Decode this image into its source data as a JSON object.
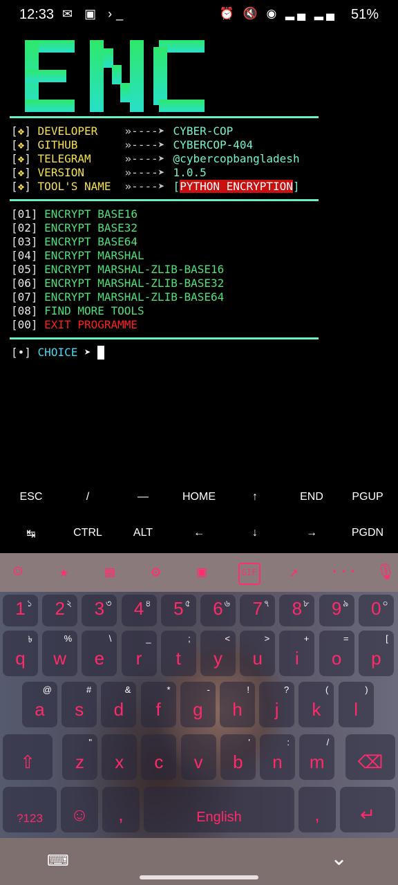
{
  "status": {
    "time": "12:33",
    "battery": "51%",
    "left_icons": "✉ ▣ ›_",
    "right_icons": "⏰ 🔇 ◉ ▂▄ ▂▄"
  },
  "logo": {
    "text": "ENC"
  },
  "info": [
    {
      "label": "DEVELOPER",
      "value": "CYBER-COP"
    },
    {
      "label": "GITHUB",
      "value": "CYBERCOP-404"
    },
    {
      "label": "TELEGRAM",
      "value": "@cybercopbangladesh"
    },
    {
      "label": "VERSION",
      "value": "1.0.5"
    },
    {
      "label": "TOOL'S NAME",
      "value": "PYTHON ENCRYPTION"
    }
  ],
  "arrow": "»----➤",
  "info_bullet": "❖",
  "menu": [
    {
      "num": "01",
      "label": "ENCRYPT BASE16"
    },
    {
      "num": "02",
      "label": "ENCRYPT BASE32"
    },
    {
      "num": "03",
      "label": "ENCRYPT BASE64"
    },
    {
      "num": "04",
      "label": "ENCRYPT MARSHAL"
    },
    {
      "num": "05",
      "label": "ENCRYPT MARSHAL-ZLIB-BASE16"
    },
    {
      "num": "06",
      "label": "ENCRYPT MARSHAL-ZLIB-BASE32"
    },
    {
      "num": "07",
      "label": "ENCRYPT MARSHAL-ZLIB-BASE64"
    },
    {
      "num": "08",
      "label": "FIND MORE TOOLS"
    },
    {
      "num": "00",
      "label": "EXIT PROGRAMME"
    }
  ],
  "prompt": {
    "bullet": "•",
    "label": "CHOICE",
    "arrow": "➤"
  },
  "extra_keys": {
    "row1": [
      "ESC",
      "/",
      "—",
      "HOME",
      "↑",
      "END",
      "PGUP"
    ],
    "row2": [
      "↹",
      "CTRL",
      "ALT",
      "←",
      "↓",
      "→",
      "PGDN"
    ]
  },
  "keyboard": {
    "toolbar_icons": [
      "☺",
      "★",
      "▤",
      "⚙",
      "▣",
      "GIF",
      "↗",
      "···",
      "🎙"
    ],
    "row1": [
      [
        "1",
        "১"
      ],
      [
        "2",
        "২"
      ],
      [
        "3",
        "৩"
      ],
      [
        "4",
        "৪"
      ],
      [
        "5",
        "৫"
      ],
      [
        "6",
        "৬"
      ],
      [
        "7",
        "৭"
      ],
      [
        "8",
        "৮"
      ],
      [
        "9",
        "৯"
      ],
      [
        "0",
        "০"
      ]
    ],
    "row2": [
      [
        "q",
        "৳"
      ],
      [
        "w",
        "%"
      ],
      [
        "e",
        "\\"
      ],
      [
        "r",
        "_"
      ],
      [
        "t",
        ";"
      ],
      [
        "y",
        "<"
      ],
      [
        "u",
        ">"
      ],
      [
        "i",
        "+"
      ],
      [
        "o",
        "="
      ],
      [
        "p",
        "["
      ]
    ],
    "row3": [
      [
        "a",
        "@"
      ],
      [
        "s",
        "#"
      ],
      [
        "d",
        "&"
      ],
      [
        "f",
        "*"
      ],
      [
        "g",
        "-"
      ],
      [
        "h",
        "!"
      ],
      [
        "j",
        "?"
      ],
      [
        "k",
        "("
      ],
      [
        "l",
        ")"
      ]
    ],
    "row4": [
      [
        "z",
        "\""
      ],
      [
        "x",
        ""
      ],
      [
        "c",
        ""
      ],
      [
        "v",
        ""
      ],
      [
        "b",
        "'"
      ],
      [
        "n",
        ":"
      ],
      [
        "m",
        "/"
      ]
    ],
    "symbols_label": "?123",
    "comma": ",",
    "space_label": "English",
    "emoji": "☺",
    "enter": "↵",
    "shift": "⇧",
    "backspace": "⌫"
  },
  "nav": {
    "keyboard_icon": "⌨",
    "hide_icon": "⌄"
  },
  "colors": {
    "green": "#4fe07a",
    "yellow": "#f4e04a",
    "teal": "#6ef5d0",
    "red": "#ff1d1d",
    "cyan": "#40d9f0",
    "key_pink": "#ff2a6a"
  }
}
